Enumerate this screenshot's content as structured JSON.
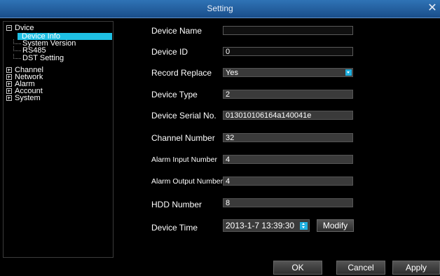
{
  "window": {
    "title": "Setting",
    "close_glyph": "✕",
    "close_icon": "close-icon"
  },
  "tree": {
    "root": "Dvice",
    "children": [
      "Device Info",
      "System Version",
      "RS485",
      "DST Setting"
    ],
    "others": [
      "Channel",
      "Network",
      "Alarm",
      "Account",
      "System"
    ]
  },
  "form": {
    "device_name": {
      "label": "Device Name",
      "value": ""
    },
    "device_id": {
      "label": "Device ID",
      "value": "0"
    },
    "record_replace": {
      "label": "Record Replace",
      "value": "Yes"
    },
    "device_type": {
      "label": "Device Type",
      "value": "2"
    },
    "serial_no": {
      "label": "Device Serial No.",
      "value": "013010106164a140041e"
    },
    "channel_number": {
      "label": "Channel Number",
      "value": "32"
    },
    "alarm_input": {
      "label": "Alarm Input Number",
      "value": "4"
    },
    "alarm_output": {
      "label": "Alarm Output Number",
      "value": "4"
    },
    "hdd_number": {
      "label": "HDD Number",
      "value": "8"
    },
    "device_time": {
      "label": "Device Time",
      "value": "2013-1-7 13:39:30",
      "modify_label": "Modify"
    }
  },
  "buttons": {
    "ok": "OK",
    "cancel": "Cancel",
    "apply": "Apply"
  },
  "colors": {
    "selection": "#1fc0e4",
    "titlebar": "#2f73b6"
  }
}
